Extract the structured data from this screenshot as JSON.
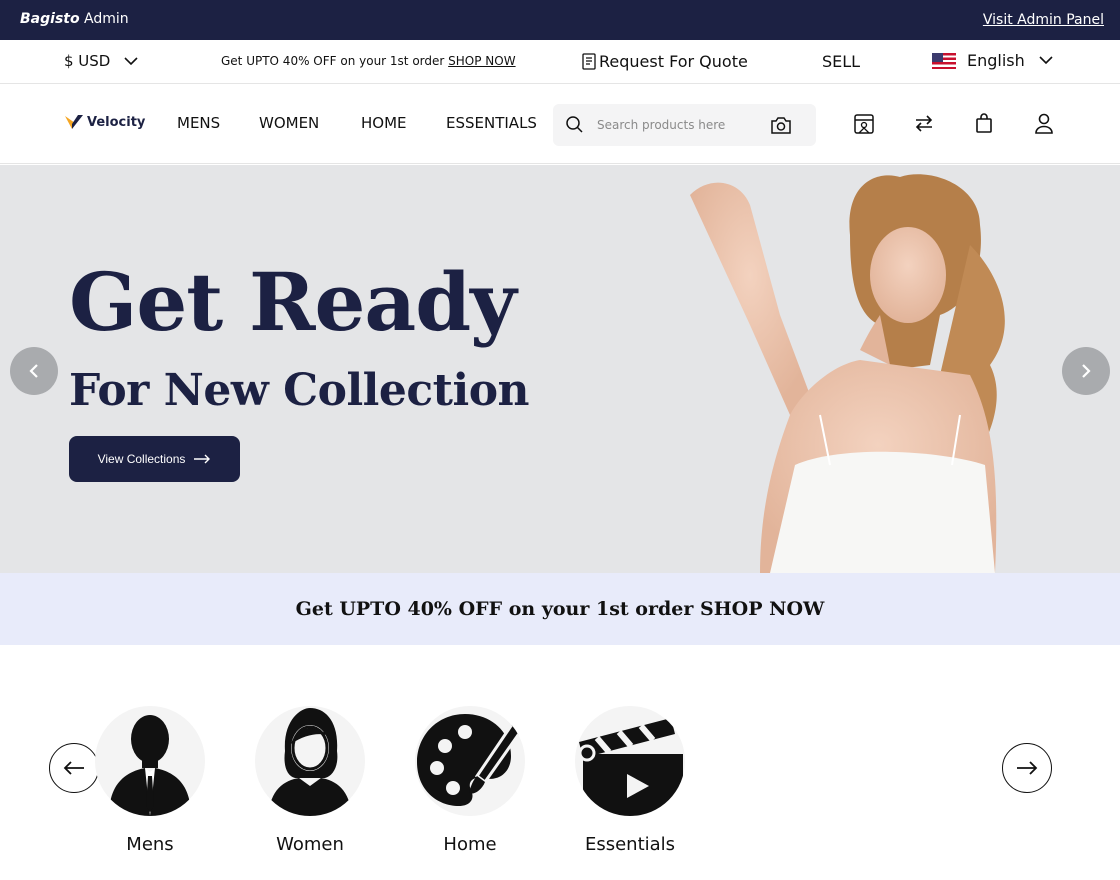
{
  "admin_bar": {
    "brand_bold": "Bagisto",
    "brand_rest": " Admin",
    "link": "Visit Admin Panel"
  },
  "top_strip": {
    "currency": "$ USD",
    "promo_text": "Get UPTO 40% OFF on your 1st order ",
    "promo_link": "SHOP NOW",
    "quote": "Request For Quote",
    "sell": "SELL",
    "language": "English"
  },
  "header": {
    "logo": "Velocity",
    "nav": [
      "MENS",
      "WOMEN",
      "HOME",
      "ESSENTIALS"
    ],
    "search_placeholder": "Search products here"
  },
  "hero": {
    "title_line1": "Get Ready",
    "title_line2": "For New Collection",
    "button": "View Collections"
  },
  "offer_banner": "Get UPTO 40% OFF on your 1st order SHOP NOW",
  "categories": [
    {
      "label": "Mens",
      "icon": "man-in-suit-icon"
    },
    {
      "label": "Women",
      "icon": "woman-icon"
    },
    {
      "label": "Home",
      "icon": "paint-palette-icon"
    },
    {
      "label": "Essentials",
      "icon": "clapperboard-icon"
    }
  ],
  "colors": {
    "navy": "#1c2143",
    "offer_bg": "#e8ebfa",
    "hero_bg": "#e4e5e7"
  }
}
